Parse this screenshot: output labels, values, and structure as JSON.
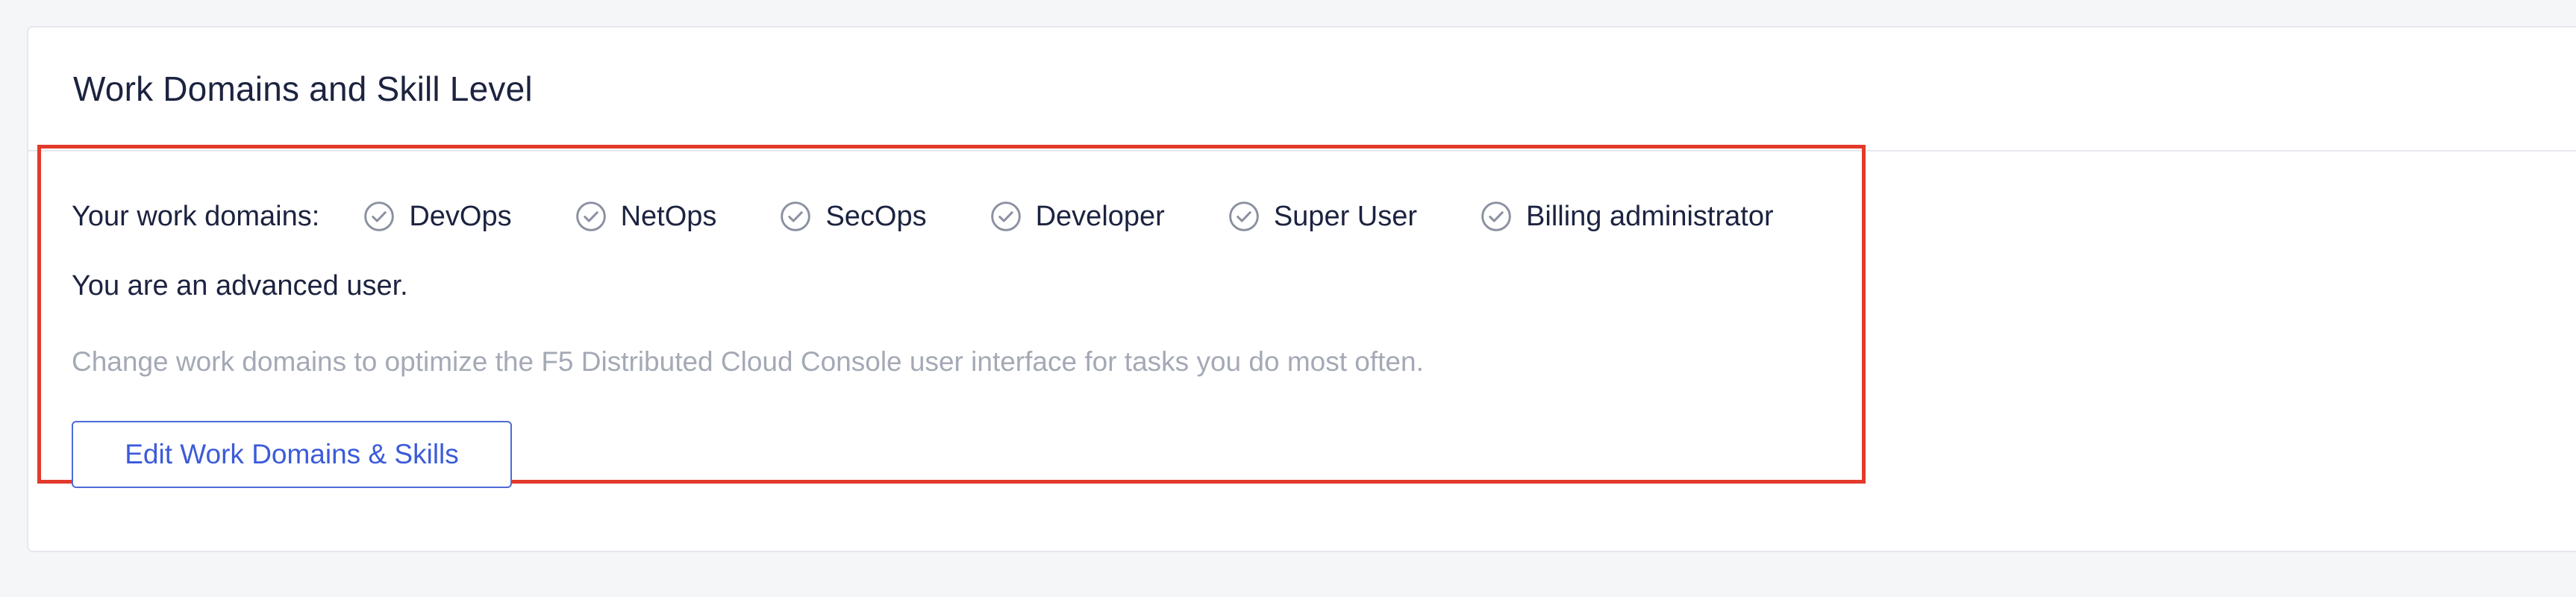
{
  "card": {
    "title": "Work Domains and Skill Level"
  },
  "domains": {
    "label": "Your work domains:",
    "items": [
      {
        "label": "DevOps",
        "icon": "check-circle-icon"
      },
      {
        "label": "NetOps",
        "icon": "check-circle-icon"
      },
      {
        "label": "SecOps",
        "icon": "check-circle-icon"
      },
      {
        "label": "Developer",
        "icon": "check-circle-icon"
      },
      {
        "label": "Super User",
        "icon": "check-circle-icon"
      },
      {
        "label": "Billing administrator",
        "icon": "check-circle-icon"
      }
    ]
  },
  "skill": {
    "text": "You are an advanced user."
  },
  "hint": {
    "text": "Change work domains to optimize the F5 Distributed Cloud Console user interface for tasks you do most often."
  },
  "actions": {
    "edit_label": "Edit Work Domains & Skills"
  },
  "colors": {
    "highlight": "#e23a2b",
    "accent": "#3b5bd9",
    "text": "#1c2340",
    "muted": "#a4a9b6",
    "icon": "#8a90a0"
  }
}
